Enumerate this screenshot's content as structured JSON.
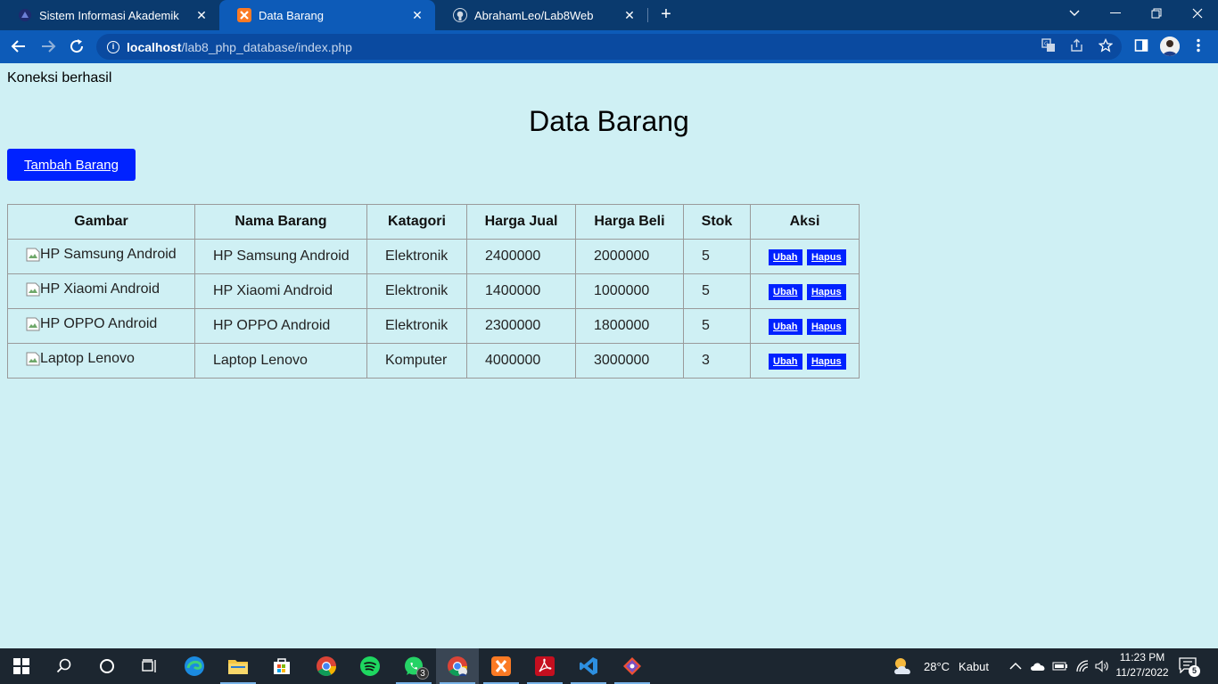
{
  "browser": {
    "tabs": [
      {
        "title": "Sistem Informasi Akademik",
        "icon": "university-icon",
        "active": false
      },
      {
        "title": "Data Barang",
        "icon": "xampp-icon",
        "active": true
      },
      {
        "title": "AbrahamLeo/Lab8Web",
        "icon": "github-icon",
        "active": false
      }
    ],
    "url": {
      "host": "localhost",
      "path": "/lab8_php_database/index.php"
    }
  },
  "page": {
    "connection_message": "Koneksi berhasil",
    "title": "Data Barang",
    "add_button": "Tambah Barang",
    "table": {
      "headers": [
        "Gambar",
        "Nama Barang",
        "Katagori",
        "Harga Jual",
        "Harga Beli",
        "Stok",
        "Aksi"
      ],
      "rows": [
        {
          "image_alt": "HP Samsung Android",
          "name": "HP Samsung Android",
          "category": "Elektronik",
          "sell_price": "2400000",
          "buy_price": "2000000",
          "stock": "5"
        },
        {
          "image_alt": "HP Xiaomi Android",
          "name": "HP Xiaomi Android",
          "category": "Elektronik",
          "sell_price": "1400000",
          "buy_price": "1000000",
          "stock": "5"
        },
        {
          "image_alt": "HP OPPO Android",
          "name": "HP OPPO Android",
          "category": "Elektronik",
          "sell_price": "2300000",
          "buy_price": "1800000",
          "stock": "5"
        },
        {
          "image_alt": "Laptop Lenovo",
          "name": "Laptop Lenovo",
          "category": "Komputer",
          "sell_price": "4000000",
          "buy_price": "3000000",
          "stock": "3"
        }
      ],
      "edit_label": "Ubah",
      "delete_label": "Hapus"
    }
  },
  "taskbar": {
    "weather": {
      "temp": "28°C",
      "condition": "Kabut"
    },
    "time": "11:23 PM",
    "date": "11/27/2022",
    "whatsapp_badge": "3",
    "notification_count": "5"
  },
  "colors": {
    "page_bg": "#cff0f4",
    "button_blue": "#0022ff",
    "chrome_blue": "#0d5bb8"
  }
}
